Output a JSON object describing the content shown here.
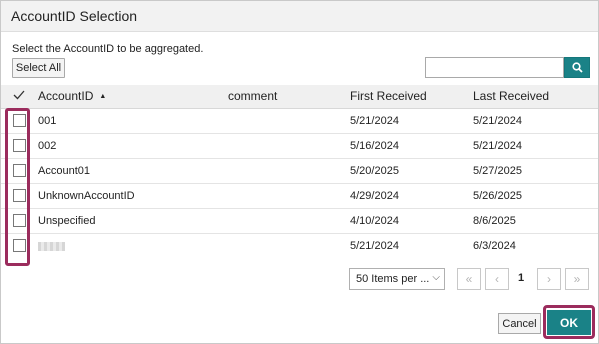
{
  "dialog": {
    "title": "AccountID Selection",
    "instruction": "Select the AccountID to be aggregated.",
    "select_all_label": "Select All",
    "search": {
      "value": "",
      "placeholder": ""
    }
  },
  "grid": {
    "columns": [
      "AccountID",
      "comment",
      "First Received",
      "Last Received"
    ],
    "sorted_column": "AccountID",
    "sort_direction": "ascending",
    "rows": [
      {
        "account_id": "001",
        "comment": "",
        "first_received": "5/21/2024",
        "last_received": "5/21/2024",
        "checked": false
      },
      {
        "account_id": "002",
        "comment": "",
        "first_received": "5/16/2024",
        "last_received": "5/21/2024",
        "checked": false
      },
      {
        "account_id": "Account01",
        "comment": "",
        "first_received": "5/20/2025",
        "last_received": "5/27/2025",
        "checked": false
      },
      {
        "account_id": "UnknownAccountID",
        "comment": "",
        "first_received": "4/29/2024",
        "last_received": "5/26/2025",
        "checked": false
      },
      {
        "account_id": "Unspecified",
        "comment": "",
        "first_received": "4/10/2024",
        "last_received": "8/6/2025",
        "checked": false
      },
      {
        "account_id": "",
        "comment": "",
        "first_received": "5/21/2024",
        "last_received": "6/3/2024",
        "checked": false
      }
    ]
  },
  "pager": {
    "items_per_page_label": "50 Items per ...",
    "current_page": "1"
  },
  "footer": {
    "cancel_label": "Cancel",
    "ok_label": "OK"
  },
  "colors": {
    "accent": "#1a8287",
    "highlight": "#9b2c5d"
  }
}
